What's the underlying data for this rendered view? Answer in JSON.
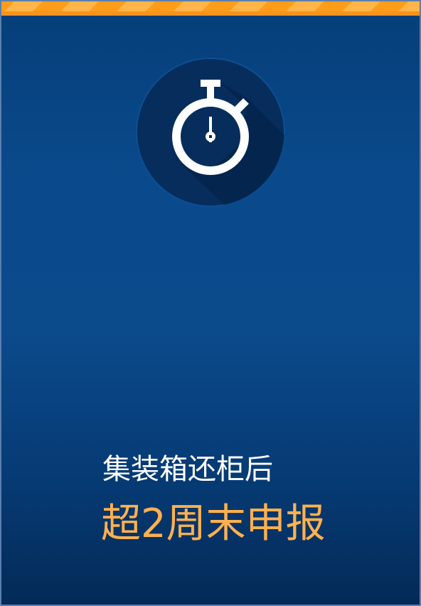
{
  "card": {
    "icon": "stopwatch-icon",
    "colors": {
      "background_top": "#063e78",
      "background_bottom": "#042a57",
      "accent": "#ffb14f",
      "stripe": "#f7931e",
      "circle": "#062d5c"
    },
    "line1": "集装箱还柜后",
    "line2": "超2周末申报"
  }
}
